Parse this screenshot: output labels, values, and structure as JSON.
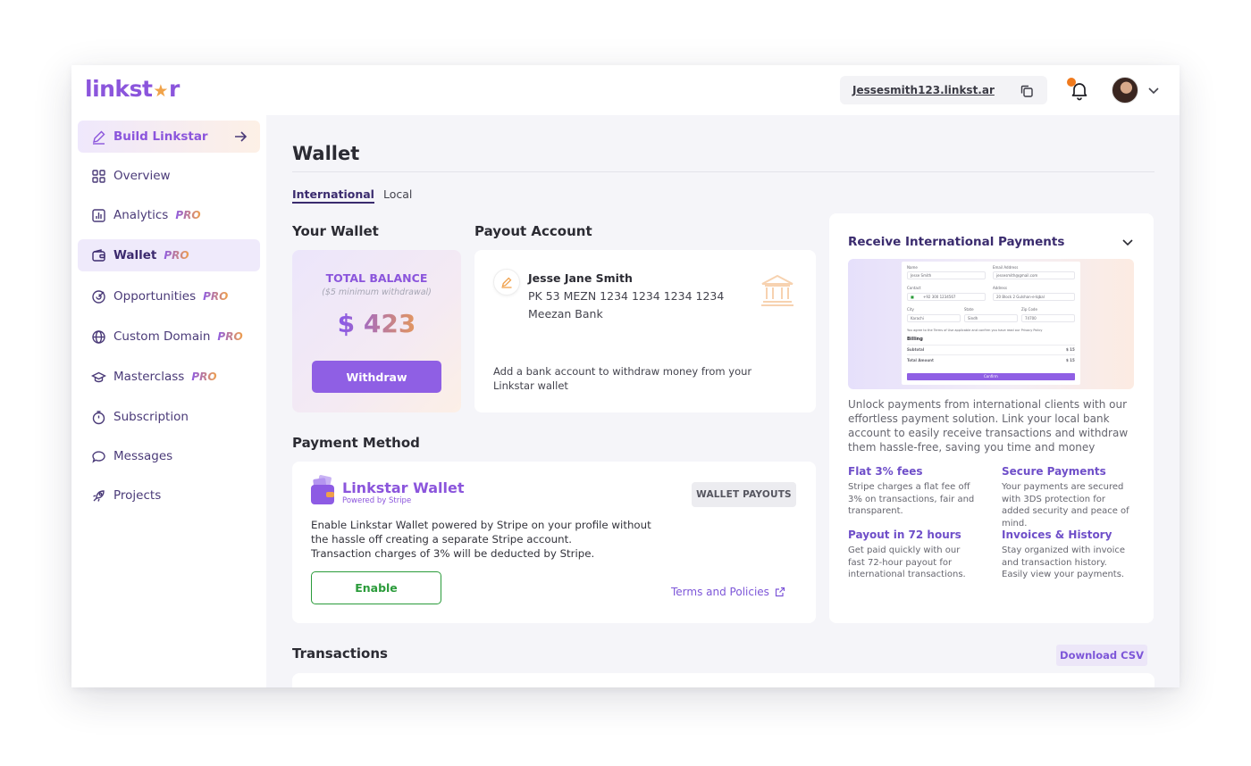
{
  "header": {
    "logo_text_a": "linkst",
    "logo_star": "★",
    "logo_text_b": "r",
    "profile_url": "Jessesmith123.linkst.ar",
    "icons": [
      "copy-icon",
      "bell-icon",
      "avatar",
      "chevron-down-icon"
    ]
  },
  "sidebar": {
    "build_label": "Build Linkstar",
    "items": [
      {
        "label": "Overview",
        "pro": "",
        "icon": "grid-icon"
      },
      {
        "label": "Analytics",
        "pro": "PRO",
        "icon": "chart-icon"
      },
      {
        "label": "Wallet",
        "pro": "PRO",
        "icon": "wallet-icon",
        "active": true
      },
      {
        "label": "Opportunities",
        "pro": "PRO",
        "icon": "opportunity-icon"
      },
      {
        "label": "Custom Domain",
        "pro": "PRO",
        "icon": "globe-icon"
      },
      {
        "label": "Masterclass",
        "pro": "PRO",
        "icon": "graduation-icon"
      },
      {
        "label": "Subscription",
        "pro": "",
        "icon": "timer-icon"
      },
      {
        "label": "Messages",
        "pro": "",
        "icon": "message-icon"
      },
      {
        "label": "Projects",
        "pro": "",
        "icon": "rocket-icon"
      }
    ]
  },
  "main": {
    "title": "Wallet",
    "tabs": [
      {
        "label": "International",
        "active": true
      },
      {
        "label": "Local",
        "active": false
      }
    ],
    "wallet": {
      "section_title": "Your Wallet",
      "balance_label": "TOTAL BALANCE",
      "balance_note": "($5 minimum withdrawal)",
      "balance_amount": "$ 423",
      "withdraw_label": "Withdraw"
    },
    "payout": {
      "section_title": "Payout Account",
      "name": "Jesse Jane Smith",
      "iban": "PK 53 MEZN 1234 1234 1234 1234",
      "bank": "Meezan Bank",
      "note": "Add a bank account to withdraw money from your Linkstar wallet"
    },
    "payment_method": {
      "section_title": "Payment Method",
      "brand_title": "Linkstar Wallet",
      "brand_sub": "Powered by Stripe",
      "badge": "WALLET PAYOUTS",
      "desc_1": "Enable Linkstar Wallet powered by Stripe on your profile without",
      "desc_2": "the hassle off creating a separate Stripe account.",
      "desc_3": "Transaction charges of 3% will be deducted by Stripe.",
      "enable_label": "Enable",
      "terms_label": "Terms and Policies"
    },
    "international": {
      "title": "Receive International Payments",
      "preview": {
        "name_label": "Name",
        "name_value": "Jesse Smith",
        "email_label": "Email Address",
        "email_value": "jessesmith@gmail.com",
        "contact_label": "Contact",
        "contact_value": "+92 300 1234567",
        "address_label": "Address",
        "address_value": "20 Block 2 Gulshan-e-Iqbal",
        "city_label": "City",
        "city_value": "Karachi",
        "state_label": "State",
        "state_value": "Sindh",
        "zip_label": "Zip Code",
        "zip_value": "74700",
        "agree_text": "You agree to the Terms of Use applicable and confirm you have read our Privacy Policy",
        "billing_label": "Billing",
        "subtotal_label": "Subtotal",
        "subtotal_value": "$ 15",
        "total_label": "Total Amount",
        "total_value": "$ 15",
        "button_label": "Confirm"
      },
      "desc": "Unlock payments from international clients with our effortless payment solution. Link your local bank account to easily receive transactions and withdraw them hassle-free, saving you time and money",
      "features": [
        {
          "title": "Flat 3% fees",
          "text": "Stripe charges a flat fee off 3% on transactions, fair and transparent."
        },
        {
          "title": "Secure Payments",
          "text": "Your payments are secured with 3DS protection for added security and peace of mind."
        },
        {
          "title": "Payout in 72 hours",
          "text": "Get paid quickly with our fast 72-hour payout for international transactions."
        },
        {
          "title": "Invoices & History",
          "text": "Stay organized with invoice and transaction history. Easily view your payments."
        }
      ]
    },
    "transactions": {
      "title": "Transactions",
      "download_label": "Download CSV"
    }
  },
  "colors": {
    "accent": "#8b55dc",
    "accent_orange": "#f0a04a",
    "enable_green": "#2a9b3a",
    "notification_dot": "#f07a1d"
  }
}
